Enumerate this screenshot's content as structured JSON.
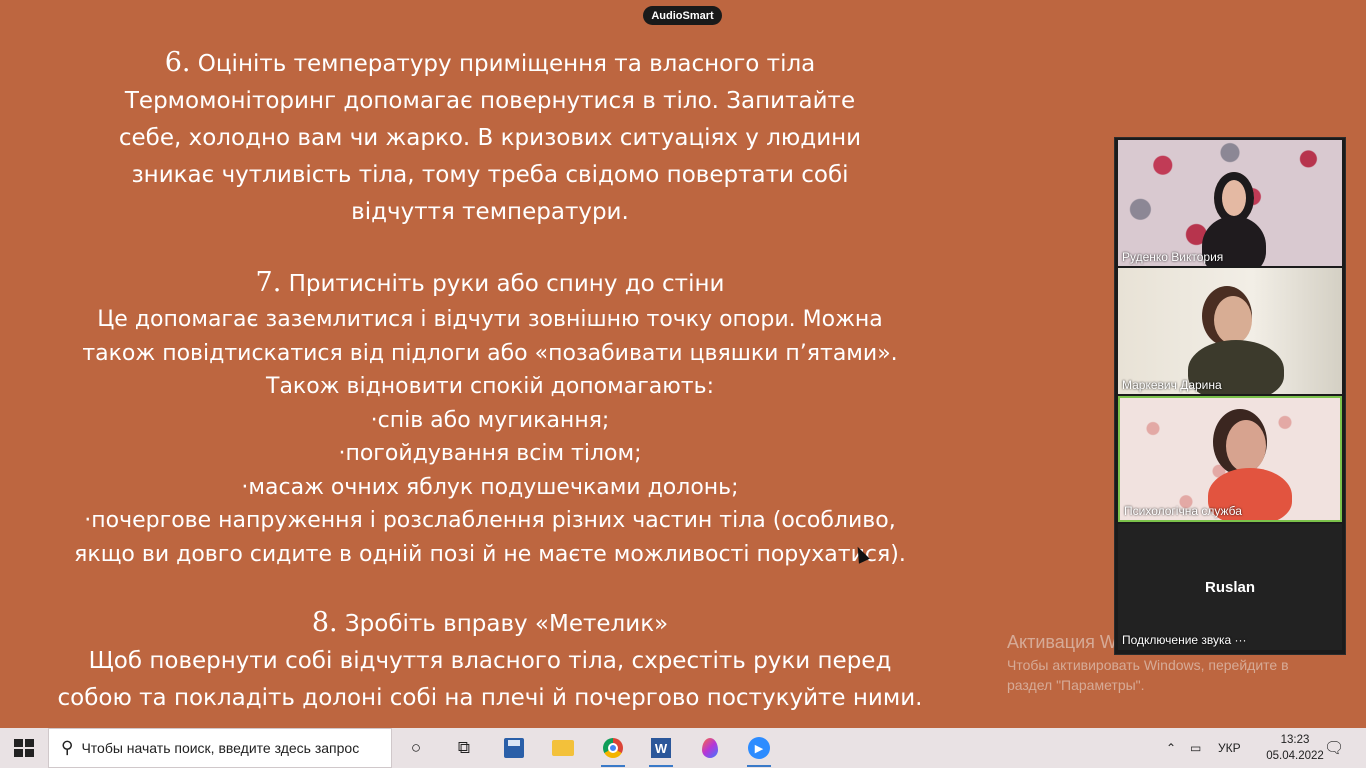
{
  "overlay_badge": "AudioSmart",
  "slide": {
    "lines": [
      {
        "num": "6.",
        "text": " Оцініть температуру приміщення та власного тіла"
      },
      {
        "text": "Термомоніторинг допомагає повернутися в тіло. Запитайте"
      },
      {
        "text": "себе, холодно вам чи жарко. В кризових ситуаціях у людини"
      },
      {
        "text": "зникає чутливість тіла, тому треба свідомо повертати собі"
      },
      {
        "text": "відчуття температури."
      },
      {
        "num": "7.",
        "text": " Притисніть руки або спину до стіни"
      },
      {
        "text": "Це допомагає заземлитися і відчути зовнішню точку опори. Можна"
      },
      {
        "text": "також повідтискатися від підлоги або «позабивати цвяшки п’ятами»."
      },
      {
        "text": "Також відновити спокій допомагають:"
      },
      {
        "text": "·спів або мугикання;"
      },
      {
        "text": "·погойдування всім тілом;"
      },
      {
        "text": "·масаж очних яблук подушечками долонь;"
      },
      {
        "text": "·почергове напруження і розслаблення різних частин тіла (особливо,"
      },
      {
        "text": "якщо ви довго сидите в одній позі й не маєте можливості поруxатися)."
      },
      {
        "num": "8.",
        "text": " Зробіть вправу «Метелик»"
      },
      {
        "text": "Щоб повернути собі відчуття власного тіла, схрестіть руки перед"
      },
      {
        "text": "собою та покладіть долоні собі на плечі й почергово постукуйте ними."
      }
    ]
  },
  "windows_watermark": {
    "title": "Активация W",
    "subtitle": "Чтобы активировать Windows, перейдите в раздел \"Параметры\"."
  },
  "participants": [
    {
      "name": "Руденко  Виктория"
    },
    {
      "name": "Маркевич Дарина"
    },
    {
      "name": "Психологічна служба"
    },
    {
      "name": "Подключение звука ···",
      "center_label": "Ruslan"
    }
  ],
  "taskbar": {
    "search_placeholder": "Чтобы начать поиск, введите здесь запрос",
    "search_icon": "search-icon",
    "apps": [
      "task-view-icon",
      "app-save-icon",
      "file-explorer-icon",
      "chrome-icon",
      "word-icon",
      "color-app-icon",
      "zoom-icon"
    ],
    "language": "УКР",
    "time": "13:23",
    "date": "05.04.2022"
  }
}
